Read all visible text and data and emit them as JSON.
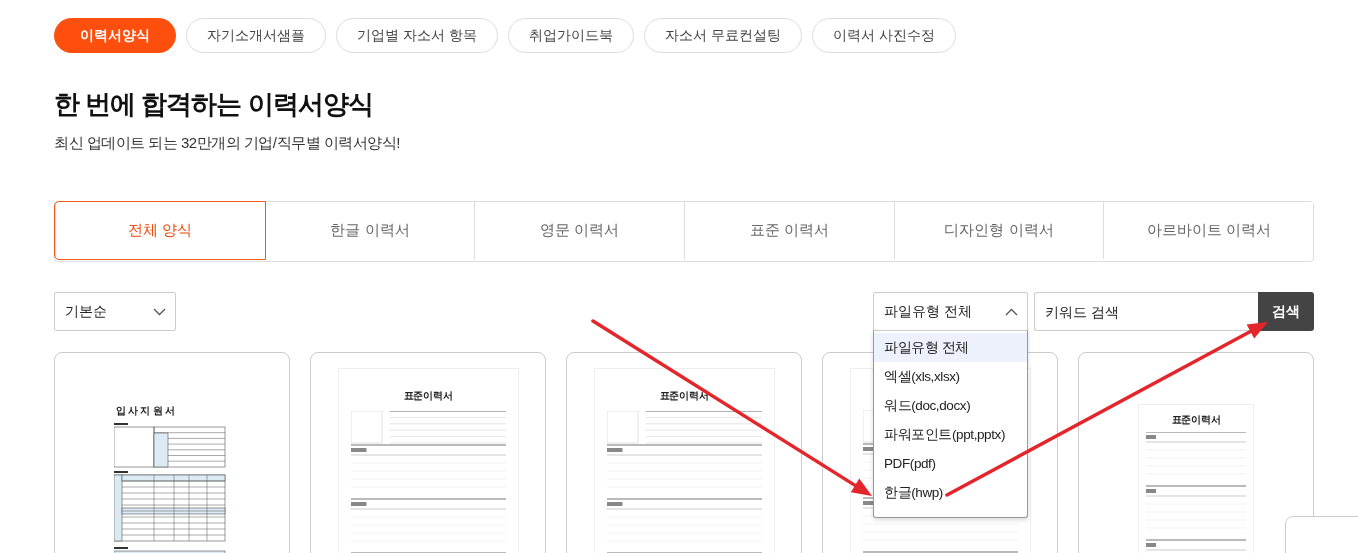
{
  "nav_pills": [
    {
      "label": "이력서양식",
      "selected": true
    },
    {
      "label": "자기소개서샘플",
      "selected": false
    },
    {
      "label": "기업별 자소서 항목",
      "selected": false
    },
    {
      "label": "취업가이드북",
      "selected": false
    },
    {
      "label": "자소서 무료컨설팅",
      "selected": false
    },
    {
      "label": "이력서 사진수정",
      "selected": false
    }
  ],
  "heading": "한 번에 합격하는 이력서양식",
  "subtitle": "최신 업데이트 되는 32만개의 기업/직무별 이력서양식!",
  "category_tabs": [
    {
      "label": "전체 양식",
      "selected": true
    },
    {
      "label": "한글 이력서",
      "selected": false
    },
    {
      "label": "영문 이력서",
      "selected": false
    },
    {
      "label": "표준 이력서",
      "selected": false
    },
    {
      "label": "디자인형 이력서",
      "selected": false
    },
    {
      "label": "아르바이트 이력서",
      "selected": false
    }
  ],
  "sort_select": {
    "value": "기본순",
    "expanded": false
  },
  "file_type_select": {
    "value": "파일유형 전체",
    "expanded": true,
    "options": [
      {
        "label": "파일유형 전체",
        "selected": true
      },
      {
        "label": "엑셀(xls,xlsx)",
        "selected": false
      },
      {
        "label": "워드(doc,docx)",
        "selected": false
      },
      {
        "label": "파워포인트(ppt,pptx)",
        "selected": false
      },
      {
        "label": "PDF(pdf)",
        "selected": false
      },
      {
        "label": "한글(hwp)",
        "selected": false
      }
    ]
  },
  "search": {
    "placeholder": "키워드 검색",
    "button": "검색"
  },
  "cards": [
    {
      "kind": "form",
      "title": "입 사 지 원 서"
    },
    {
      "kind": "standard",
      "title": "표준이력서"
    },
    {
      "kind": "standard",
      "title": "표준이력서"
    },
    {
      "kind": "standard"
    },
    {
      "kind": "compact",
      "title": "표준이력서"
    }
  ],
  "annotations": [
    {
      "kind": "arrow"
    },
    {
      "kind": "arrow"
    }
  ]
}
